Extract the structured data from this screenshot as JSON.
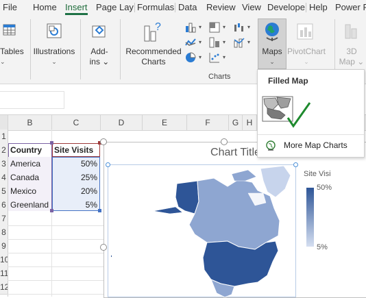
{
  "tabs": [
    "File",
    "Home",
    "Insert",
    "Page Lay",
    "Formulas",
    "Data",
    "Review",
    "View",
    "Develope",
    "Help",
    "Power P"
  ],
  "ribbon": {
    "tables": "Tables",
    "illustrations": "Illustrations",
    "addins_1": "Add-",
    "addins_2": "ins",
    "recommended_1": "Recommended",
    "recommended_2": "Charts",
    "charts_group": "Charts",
    "maps": "Maps",
    "pivotchart": "PivotChart",
    "map3d_1": "3D",
    "map3d_2": "Map"
  },
  "maps_menu": {
    "title": "Filled Map",
    "more": "More Map Charts"
  },
  "columns": [
    "B",
    "C",
    "D",
    "E",
    "F",
    "G",
    "H"
  ],
  "rows": [
    "1",
    "2",
    "3",
    "4",
    "5",
    "6",
    "7",
    "8",
    "9",
    "10",
    "11",
    "12"
  ],
  "table": {
    "header": [
      "Country",
      "Site Visits"
    ],
    "data": [
      [
        "America",
        "50%"
      ],
      [
        "Canada",
        "25%"
      ],
      [
        "Mexico",
        "20%"
      ],
      [
        "Greenland",
        "5%"
      ]
    ]
  },
  "chart": {
    "title": "Chart Title",
    "legend_title": "Site Visi",
    "legend_max": "50%",
    "legend_min": "5%"
  },
  "colors": {
    "accent": "#1e7145",
    "map_dark": "#2e5597",
    "map_mid": "#8ea6d1",
    "map_light": "#c7d4ec",
    "selection": "#9e3a3a"
  }
}
